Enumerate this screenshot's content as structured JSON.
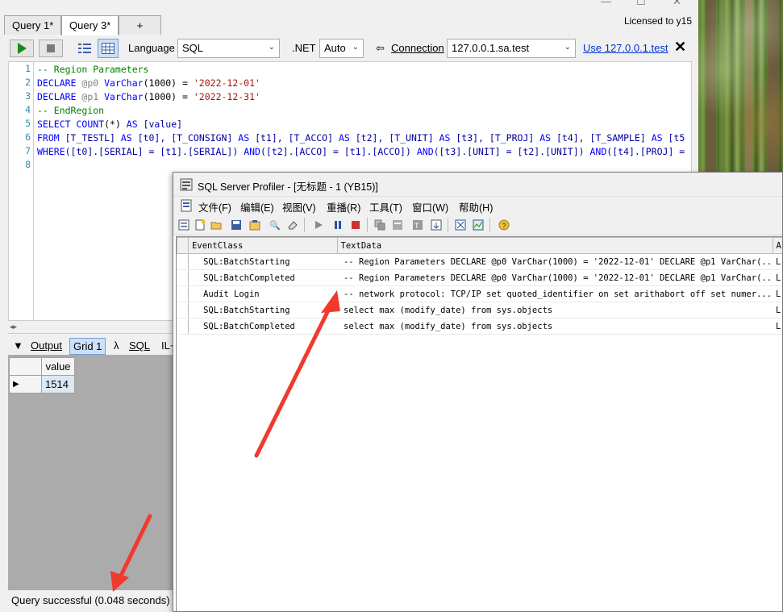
{
  "window": {
    "tabs": [
      {
        "label": "Query 1*"
      },
      {
        "label": "Query 3*"
      },
      {
        "label": "+"
      }
    ],
    "licensed": "Licensed to y15"
  },
  "toolbar": {
    "language_label": "Language",
    "language_value": "SQL",
    "net_label": ".NET",
    "net_value": "Auto",
    "connection_label": "Connection",
    "connection_value": "127.0.0.1.sa.test",
    "use_link": "Use 127.0.0.1.test"
  },
  "editor": {
    "lines": [
      {
        "n": "1",
        "parts": [
          {
            "t": "-- Region Parameters",
            "c": "cm"
          }
        ]
      },
      {
        "n": "2",
        "parts": [
          {
            "t": "DECLARE ",
            "c": "kw"
          },
          {
            "t": "@p0 ",
            "c": "var"
          },
          {
            "t": "VarChar",
            "c": "kw"
          },
          {
            "t": "(1000) = ",
            "c": ""
          },
          {
            "t": "'2022-12-01'",
            "c": "str"
          }
        ]
      },
      {
        "n": "3",
        "parts": [
          {
            "t": "DECLARE ",
            "c": "kw"
          },
          {
            "t": "@p1 ",
            "c": "var"
          },
          {
            "t": "VarChar",
            "c": "kw"
          },
          {
            "t": "(1000) = ",
            "c": ""
          },
          {
            "t": "'2022-12-31'",
            "c": "str"
          }
        ]
      },
      {
        "n": "4",
        "parts": [
          {
            "t": "-- EndRegion",
            "c": "cm"
          }
        ]
      },
      {
        "n": "5",
        "parts": [
          {
            "t": "SELECT ",
            "c": "kw"
          },
          {
            "t": "COUNT",
            "c": "kw"
          },
          {
            "t": "(*) ",
            "c": ""
          },
          {
            "t": "AS ",
            "c": "kw"
          },
          {
            "t": "[value]",
            "c": "id"
          }
        ]
      },
      {
        "n": "6",
        "parts": [
          {
            "t": "FROM ",
            "c": "kw"
          },
          {
            "t": "[T_TESTL] ",
            "c": "id"
          },
          {
            "t": "AS ",
            "c": "kw"
          },
          {
            "t": "[t0], ",
            "c": "id"
          },
          {
            "t": "[T_CONSIGN] ",
            "c": "id"
          },
          {
            "t": "AS ",
            "c": "kw"
          },
          {
            "t": "[t1], ",
            "c": "id"
          },
          {
            "t": "[T_ACCO] ",
            "c": "id"
          },
          {
            "t": "AS ",
            "c": "kw"
          },
          {
            "t": "[t2], ",
            "c": "id"
          },
          {
            "t": "[T_UNIT] ",
            "c": "id"
          },
          {
            "t": "AS ",
            "c": "kw"
          },
          {
            "t": "[t3], ",
            "c": "id"
          },
          {
            "t": "[T_PROJ] ",
            "c": "id"
          },
          {
            "t": "AS ",
            "c": "kw"
          },
          {
            "t": "[t4], ",
            "c": "id"
          },
          {
            "t": "[T_SAMPLE] ",
            "c": "id"
          },
          {
            "t": "AS ",
            "c": "kw"
          },
          {
            "t": "[t5",
            "c": "id"
          }
        ]
      },
      {
        "n": "7",
        "parts": [
          {
            "t": "WHERE",
            "c": "kw"
          },
          {
            "t": "([t0].[SERIAL] = [t1].[SERIAL]) ",
            "c": "id"
          },
          {
            "t": "AND",
            "c": "kw"
          },
          {
            "t": "([t2].[ACCO] = [t1].[ACCO]) ",
            "c": "id"
          },
          {
            "t": "AND",
            "c": "kw"
          },
          {
            "t": "([t3].[UNIT] = [t2].[UNIT]) ",
            "c": "id"
          },
          {
            "t": "AND",
            "c": "kw"
          },
          {
            "t": "([t4].[PROJ] =",
            "c": "id"
          }
        ]
      },
      {
        "n": "8",
        "parts": []
      }
    ]
  },
  "results": {
    "tabs": [
      "Output",
      "Grid 1",
      "λ",
      "SQL",
      "IL+"
    ],
    "column": "value",
    "value": "1514",
    "status": "Query successful  (0.048 seconds)"
  },
  "profiler": {
    "title": "SQL Server Profiler - [无标题 - 1 (YB15)]",
    "menu": [
      "文件(F)",
      "编辑(E)",
      "视图(V)",
      "重播(R)",
      "工具(T)",
      "窗口(W)",
      "帮助(H)"
    ],
    "columns": [
      "EventClass",
      "TextData",
      "A"
    ],
    "rows": [
      {
        "event": "SQL:BatchStarting",
        "text": "-- Region Parameters  DECLARE @p0 VarChar(1000) = '2022-12-01'  DECLARE @p1 VarChar(...",
        "app": "L"
      },
      {
        "event": "SQL:BatchCompleted",
        "text": "-- Region Parameters  DECLARE @p0 VarChar(1000) = '2022-12-01'  DECLARE @p1 VarChar(...",
        "app": "L"
      },
      {
        "event": "Audit Login",
        "text": "-- network protocol: TCP/IP  set quoted_identifier on  set arithabort off  set numer...",
        "app": "L"
      },
      {
        "event": "SQL:BatchStarting",
        "text": "select max (modify_date) from sys.objects",
        "app": "L"
      },
      {
        "event": "SQL:BatchCompleted",
        "text": "select max (modify_date) from sys.objects",
        "app": "L"
      }
    ]
  },
  "colors": {
    "arrow": "#f03a2e",
    "link": "#0033cc",
    "comment": "#008000",
    "keyword": "#0000ff",
    "string": "#a31515"
  }
}
